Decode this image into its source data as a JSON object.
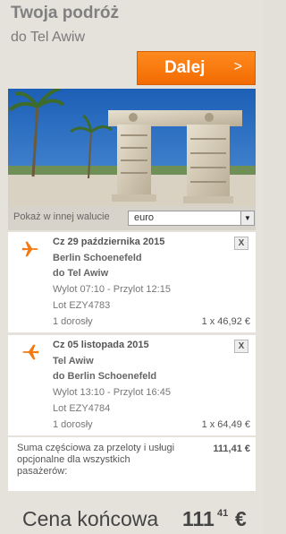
{
  "header": {
    "title": "Twoja podróż",
    "subtitle": "do Tel Awiw",
    "next_label": "Dalej",
    "next_arrow": ">"
  },
  "currency": {
    "label": "Pokaż w innej walucie",
    "selected": "euro"
  },
  "flights": [
    {
      "date": "Cz 29 października 2015",
      "from": "Berlin Schoenefeld",
      "to": "do Tel Awiw",
      "times": "Wylot 07:10 - Przylot 12:15",
      "flight_no": "Lot EZY4783",
      "passengers": "1 dorosły",
      "price": "1 x 46,92 €",
      "remove_label": "X"
    },
    {
      "date": "Cz 05 listopada 2015",
      "from": "Tel Awiw",
      "to": "do Berlin Schoenefeld",
      "times": "Wylot 13:10 - Przylot 16:45",
      "flight_no": "Lot EZY4784",
      "passengers": "1 dorosły",
      "price": "1 x 64,49 €",
      "remove_label": "X"
    }
  ],
  "subtotal": {
    "text": "Suma częściowa za przeloty i usługi opcjonalne dla wszystkich pasażerów:",
    "amount": "111,41 €"
  },
  "total": {
    "label": "Cena końcowa",
    "integer": "111",
    "decimal": "41",
    "currency": "€"
  },
  "colors": {
    "accent": "#f47a10",
    "background": "#e3e0d9"
  }
}
